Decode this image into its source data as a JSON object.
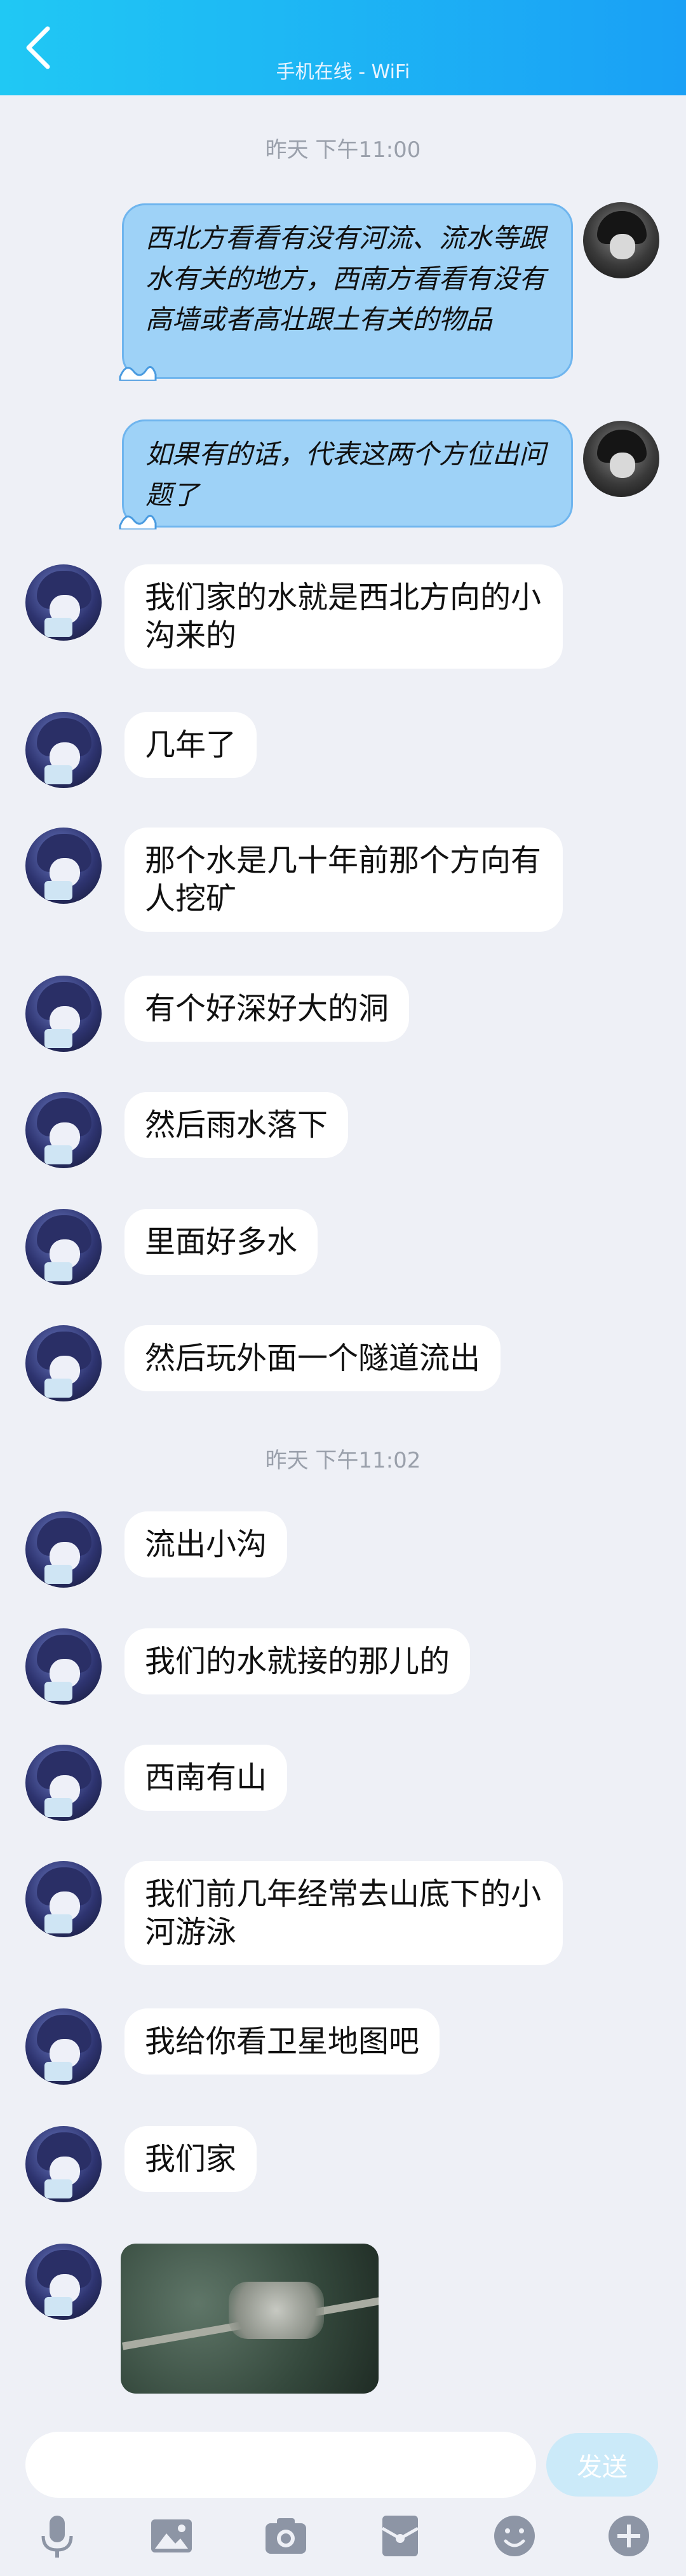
{
  "header": {
    "subtitle": "手机在线 - WiFi"
  },
  "timestamps": [
    "昨天 下午11:00",
    "昨天 下午11:02"
  ],
  "sent_messages": [
    "西北方看看有没有河流、流水等跟水有关的地方，西南方看看有没有高墙或者高壮跟土有关的物品",
    "如果有的话，代表这两个方位出问题了"
  ],
  "received_messages": [
    "我们家的水就是西北方向的小沟来的",
    "几年了",
    "那个水是几十年前那个方向有人挖矿",
    "有个好深好大的洞",
    "然后雨水落下",
    "里面好多水",
    "然后玩外面一个隧道流出",
    "流出小沟",
    "我们的水就接的那儿的",
    "西南有山",
    "我们前几年经常去山底下的小河游泳",
    "我给你看卫星地图吧",
    "我们家"
  ],
  "composer": {
    "input_value": "",
    "send_label": "发送"
  },
  "toolbar": [
    "mic-icon",
    "image-icon",
    "camera-icon",
    "red-packet-icon",
    "emoji-icon",
    "plus-icon"
  ],
  "colors": {
    "header_start": "#20c8f4",
    "header_end": "#1aa0f5",
    "sent_bubble": "#9ed2f7",
    "send_button": "#cbeaf9"
  }
}
